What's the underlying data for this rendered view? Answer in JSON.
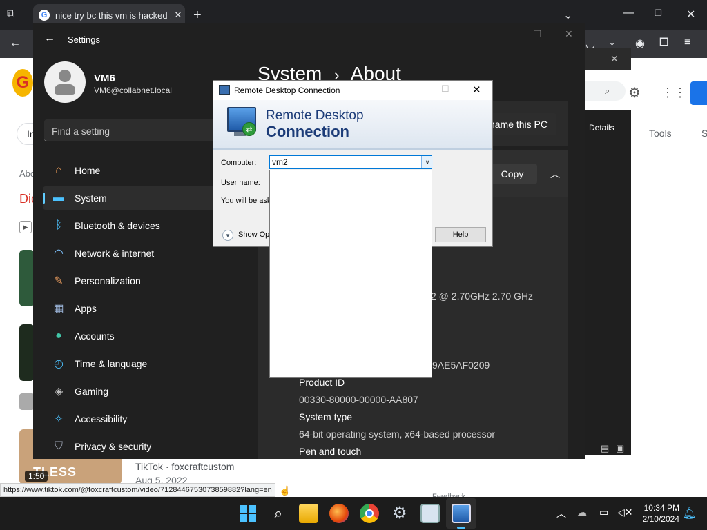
{
  "browser": {
    "tab_title": "nice try bc this vm is hacked by",
    "tools_label": "Tools",
    "details_label": "Details",
    "ab_text": "Abo",
    "dic_text": "Dic",
    "in_text": "In",
    "s_text": "S",
    "video_duration": "1:50",
    "video_channel": "TikTok · foxcraftcustom",
    "video_date": "Aug 5, 2022",
    "video_overlay": "TLESS",
    "status_url": "https://www.tiktok.com/@foxcraftcustom/video/7128446753073859882?lang=en",
    "brand_color": "#1a73e8",
    "feedback_fragment": "Feedback"
  },
  "settings": {
    "title": "Settings",
    "user_name": "VM6",
    "user_email": "VM6@collabnet.local",
    "search_placeholder": "Find a setting",
    "breadcrumb_parent": "System",
    "breadcrumb_sep": "›",
    "breadcrumb_current": "About",
    "rename_label": "name this PC",
    "copy_label": "Copy",
    "nav": [
      {
        "label": "Home",
        "icon": "home-icon"
      },
      {
        "label": "System",
        "icon": "monitor-icon",
        "selected": true
      },
      {
        "label": "Bluetooth & devices",
        "icon": "bluetooth-icon"
      },
      {
        "label": "Network & internet",
        "icon": "wifi-icon"
      },
      {
        "label": "Personalization",
        "icon": "brush-icon"
      },
      {
        "label": "Apps",
        "icon": "apps-icon"
      },
      {
        "label": "Accounts",
        "icon": "person-icon"
      },
      {
        "label": "Time & language",
        "icon": "globe-clock-icon"
      },
      {
        "label": "Gaming",
        "icon": "gamepad-icon"
      },
      {
        "label": "Accessibility",
        "icon": "accessibility-icon"
      },
      {
        "label": "Privacy & security",
        "icon": "shield-icon"
      }
    ],
    "specs": {
      "processor_value": "2 @ 2.70GHz   2.70 GHz",
      "device_id_value": "9AE5AF0209",
      "product_id_label": "Product ID",
      "product_id_value": "00330-80000-00000-AA807",
      "system_type_label": "System type",
      "system_type_value": "64-bit operating system, x64-based processor",
      "pen_touch_label": "Pen and touch"
    }
  },
  "rdc": {
    "title": "Remote Desktop Connection",
    "banner_line1": "Remote Desktop",
    "banner_line2": "Connection",
    "computer_label": "Computer:",
    "computer_value": "vm2",
    "username_label": "User name:",
    "info_text": "You will be ask",
    "show_options": "Show Opt",
    "help_label": "Help"
  },
  "taskbar": {
    "time": "10:34 PM",
    "date": "2/10/2024"
  }
}
